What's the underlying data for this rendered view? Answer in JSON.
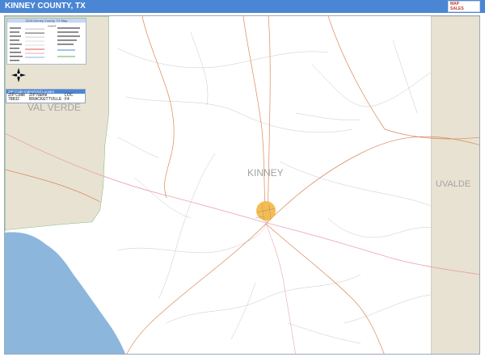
{
  "header": {
    "title": "KINNEY COUNTY, TX"
  },
  "legend": {
    "title": "2016 Kinney County, TX Map",
    "subtitle": "Legend"
  },
  "zip_table": {
    "title": "ZIP Code Index/Grid Locator",
    "columns": [
      "ZIP Code",
      "ZIP Name",
      "LOC"
    ],
    "rows": [
      [
        "78832",
        "BRACKETTVILLE",
        "F4"
      ]
    ]
  },
  "labels": {
    "kinney": "KINNEY",
    "val_verde": "VAL VERDE",
    "uvalde": "UVALDE"
  },
  "colors": {
    "header_bar": "#4a86d4",
    "water": "#8db6dc",
    "neighbor_land": "#e8e2d2",
    "county_land": "#ffffff",
    "roads": "#d9875a",
    "highway": "#e8a6b4",
    "town": "#f5b640"
  },
  "icons": [
    "compass-icon",
    "logo-icon"
  ]
}
